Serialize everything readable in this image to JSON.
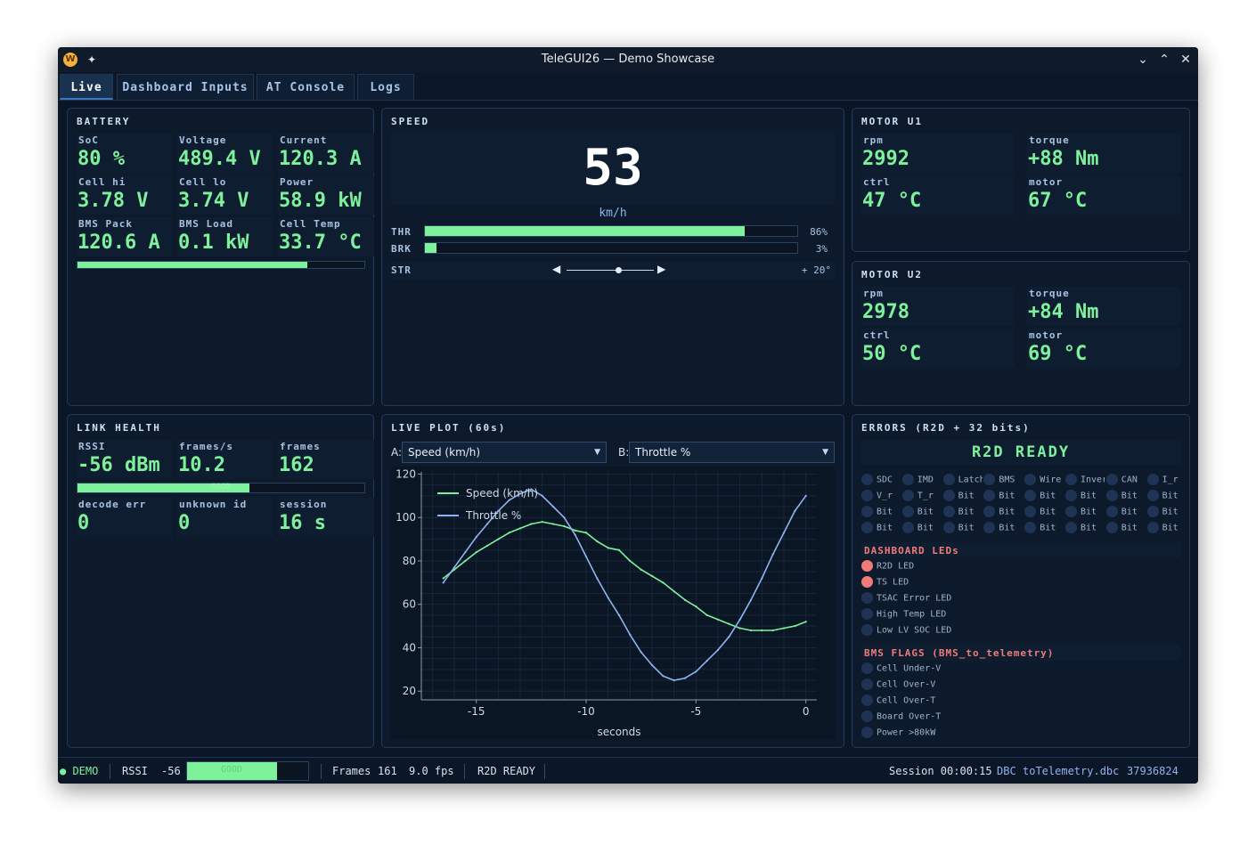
{
  "window": {
    "title": "TeleGUI26 — Demo Showcase",
    "app_icon_letter": "W"
  },
  "tabs": [
    {
      "label": "Live",
      "active": true
    },
    {
      "label": "Dashboard Inputs",
      "active": false
    },
    {
      "label": "AT Console",
      "active": false
    },
    {
      "label": "Logs",
      "active": false
    }
  ],
  "battery": {
    "title": "BATTERY",
    "cells": [
      {
        "label": "SoC",
        "value": "80 %"
      },
      {
        "label": "Voltage",
        "value": "489.4 V"
      },
      {
        "label": "Current",
        "value": "120.3 A"
      },
      {
        "label": "Cell hi",
        "value": "3.78 V"
      },
      {
        "label": "Cell lo",
        "value": "3.74 V"
      },
      {
        "label": "Power",
        "value": "58.9 kW"
      },
      {
        "label": "BMS Pack",
        "value": "120.6 A"
      },
      {
        "label": "BMS Load",
        "value": "0.1 kW"
      },
      {
        "label": "Cell Temp",
        "value": "33.7 °C"
      }
    ],
    "soc_fraction": 0.8
  },
  "speed": {
    "title": "SPEED",
    "value": "53",
    "unit": "km/h",
    "throttle": {
      "label": "THR",
      "text": "86%",
      "fraction": 0.86
    },
    "brake": {
      "label": "BRK",
      "text": "3%",
      "fraction": 0.03
    },
    "steering": {
      "label": "STR",
      "text": "+ 20°",
      "fraction": 0.6,
      "left_arrow": "◀",
      "right_arrow": "▶"
    }
  },
  "motor_u1": {
    "title": "MOTOR U1",
    "cells": [
      {
        "label": "rpm",
        "value": "2992"
      },
      {
        "label": "torque",
        "value": "+88 Nm"
      },
      {
        "label": "ctrl",
        "value": "47 °C"
      },
      {
        "label": "motor",
        "value": "67 °C"
      }
    ]
  },
  "motor_u2": {
    "title": "MOTOR U2",
    "cells": [
      {
        "label": "rpm",
        "value": "2978"
      },
      {
        "label": "torque",
        "value": "+84 Nm"
      },
      {
        "label": "ctrl",
        "value": "50 °C"
      },
      {
        "label": "motor",
        "value": "69 °C"
      }
    ]
  },
  "link": {
    "title": "LINK HEALTH",
    "cells": [
      {
        "label": "RSSI",
        "value": "-56 dBm"
      },
      {
        "label": "frames/s",
        "value": "10.2"
      },
      {
        "label": "frames",
        "value": "162"
      },
      {
        "label": "decode err",
        "value": "0"
      },
      {
        "label": "unknown id",
        "value": "0"
      },
      {
        "label": "session",
        "value": "16 s"
      }
    ],
    "rssi_fraction": 0.6,
    "bar_text": "GOOD"
  },
  "plot": {
    "title": "LIVE PLOT  (60s)",
    "a_label": "A:",
    "a_value": "Speed (km/h)",
    "b_label": "B:",
    "b_value": "Throttle %",
    "series_colors": {
      "speed": "#7ef29b",
      "throttle": "#8fb4f0"
    }
  },
  "chart_data": {
    "type": "line",
    "xlabel": "seconds",
    "ylabel": "",
    "xlim": [
      -17.5,
      0.5
    ],
    "ylim": [
      16,
      121
    ],
    "xticks": [
      -15,
      -10,
      -5,
      0
    ],
    "yticks": [
      20,
      40,
      60,
      80,
      100,
      120
    ],
    "grid": true,
    "legend": "top-left",
    "series": [
      {
        "name": "Speed (km/h)",
        "color": "#7ef29b",
        "x": [
          -16.5,
          -16,
          -15.5,
          -15,
          -14.5,
          -14,
          -13.5,
          -13,
          -12.5,
          -12,
          -11.5,
          -11,
          -10.5,
          -10,
          -9.5,
          -9,
          -8.5,
          -8,
          -7.5,
          -7,
          -6.5,
          -6,
          -5.5,
          -5,
          -4.5,
          -4,
          -3.5,
          -3,
          -2.5,
          -2,
          -1.5,
          -1,
          -0.5,
          0
        ],
        "y": [
          72,
          76,
          80,
          84,
          87,
          90,
          93,
          95,
          97,
          98,
          97,
          96,
          94,
          93,
          89,
          86,
          85,
          80,
          76,
          73,
          70,
          66,
          62,
          59,
          55,
          53,
          51,
          49,
          48,
          48,
          48,
          49,
          50,
          52
        ]
      },
      {
        "name": "Throttle %",
        "color": "#8fb4f0",
        "x": [
          -16.5,
          -16,
          -15.5,
          -15,
          -14.5,
          -14,
          -13.5,
          -13,
          -12.5,
          -12,
          -11.5,
          -11,
          -10.5,
          -10,
          -9.5,
          -9,
          -8.5,
          -8,
          -7.5,
          -7,
          -6.5,
          -6,
          -5.5,
          -5,
          -4.5,
          -4,
          -3.5,
          -3,
          -2.5,
          -2,
          -1.5,
          -1,
          -0.5,
          0
        ],
        "y": [
          70,
          77,
          84,
          91,
          97,
          103,
          108,
          111,
          113,
          110,
          105,
          100,
          92,
          82,
          72,
          63,
          55,
          46,
          38,
          32,
          27,
          25,
          26,
          29,
          34,
          39,
          45,
          53,
          62,
          72,
          83,
          93,
          103,
          110
        ]
      }
    ]
  },
  "errors": {
    "title": "ERRORS  (R2D + 32 bits)",
    "banner": "R2D  READY",
    "bits": [
      "SDC",
      "IMD",
      "Latch",
      "BMS",
      "Wire",
      "Inverter",
      "CAN",
      "I_r",
      "V_r",
      "T_r",
      "Bit",
      "Bit",
      "Bit",
      "Bit",
      "Bit",
      "Bit",
      "Bit",
      "Bit",
      "Bit",
      "Bit",
      "Bit",
      "Bit",
      "Bit",
      "Bit",
      "Bit",
      "Bit",
      "Bit",
      "Bit",
      "Bit",
      "Bit",
      "Bit",
      "Bit"
    ],
    "leds_title": "DASHBOARD LEDs",
    "leds": [
      {
        "label": "R2D LED",
        "on": true
      },
      {
        "label": "TS LED",
        "on": true
      },
      {
        "label": "TSAC Error LED",
        "on": false
      },
      {
        "label": "High Temp LED",
        "on": false
      },
      {
        "label": "Low LV SOC LED",
        "on": false
      }
    ],
    "bms_title": "BMS FLAGS (BMS_to_telemetry)",
    "bms_flags": [
      {
        "label": "Cell Under-V",
        "on": false
      },
      {
        "label": "Cell Over-V",
        "on": false
      },
      {
        "label": "Cell Over-T",
        "on": false
      },
      {
        "label": "Board Over-T",
        "on": false
      },
      {
        "label": "Power >80kW",
        "on": false
      }
    ],
    "red_color": "#f07b78"
  },
  "status": {
    "mode": "● DEMO",
    "rssi_label": "RSSI",
    "rssi_value": "-56",
    "rssi_bar_text": "GOOD",
    "rssi_fraction": 0.74,
    "frames_label": "Frames",
    "frames_value": "161",
    "fps": "9.0 fps",
    "state": "R2D READY",
    "session": "Session 00:00:15",
    "dbc_label": "DBC",
    "dbc_file": "toTelemetry.dbc",
    "dbc_hash": "37936824"
  }
}
